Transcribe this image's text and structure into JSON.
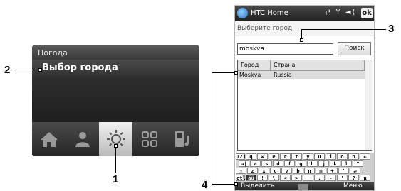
{
  "callouts": [
    "1",
    "2",
    "3",
    "4"
  ],
  "widget": {
    "header_title": "Погода",
    "city_label": "Выбор города",
    "tab_icons": [
      "home-icon",
      "person-icon",
      "sun-icon",
      "grid-icon",
      "phone-music-icon"
    ],
    "active_tab_index": 2
  },
  "phone": {
    "title": "HTC Home",
    "status_icons": "⇄ Y ◄(",
    "ok_label": "ok",
    "subtitle": "Выберите город",
    "search_value": "moskva",
    "search_button": "Поиск",
    "columns": [
      "Город",
      "Страна"
    ],
    "rows": [
      {
        "city": "Moskva",
        "country": "Russia"
      }
    ],
    "keyboard_rows": [
      [
        "123",
        "q",
        "w",
        "e",
        "r",
        "t",
        "y",
        "u",
        "i",
        "o",
        "p",
        "←"
      ],
      [
        "→|",
        "a",
        "s",
        "d",
        "f",
        "g",
        "h",
        "j",
        "k",
        "l",
        "\""
      ],
      [
        "⇧",
        "z",
        "x",
        "c",
        "v",
        "b",
        "n",
        "m",
        "+",
        "'",
        "↵"
      ],
      [
        "ctl",
        "áü",
        "!",
        "\\",
        "<",
        ">",
        "|",
        ",",
        "-",
        "'",
        "?",
        "μ"
      ]
    ],
    "softkey_left": "Выделить",
    "softkey_right": "Меню"
  }
}
